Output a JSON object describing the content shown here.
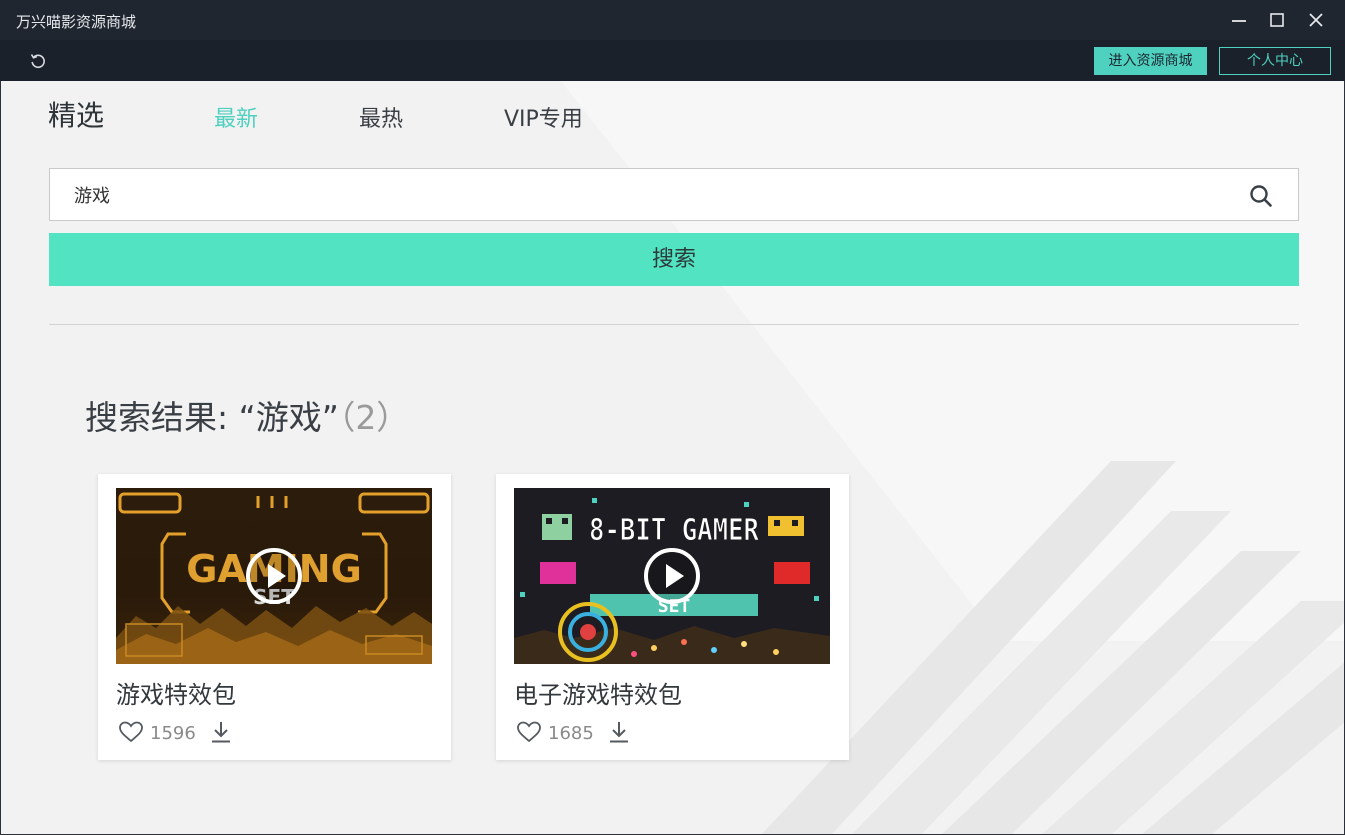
{
  "window": {
    "title": "万兴喵影资源商城"
  },
  "toolbar": {
    "store_label": "进入资源商城",
    "user_center_label": "个人中心"
  },
  "tabs": {
    "featured": "精选",
    "newest": "最新",
    "hot": "最热",
    "vip": "VIP专用"
  },
  "search": {
    "value": "游戏",
    "button_label": "搜索"
  },
  "results": {
    "title": "搜索结果: “游戏”",
    "count": "（2）",
    "items": [
      {
        "title": "游戏特效包",
        "likes": "1596",
        "thumbnail_text": "GAMING",
        "thumbnail_sub": "SET"
      },
      {
        "title": "电子游戏特效包",
        "likes": "1685",
        "thumbnail_text": "8-BIT GAMER",
        "thumbnail_sub": "SET"
      }
    ]
  },
  "colors": {
    "accent": "#4fd1c0",
    "search_button": "#52e3c2",
    "titlebar": "#1f2630"
  }
}
